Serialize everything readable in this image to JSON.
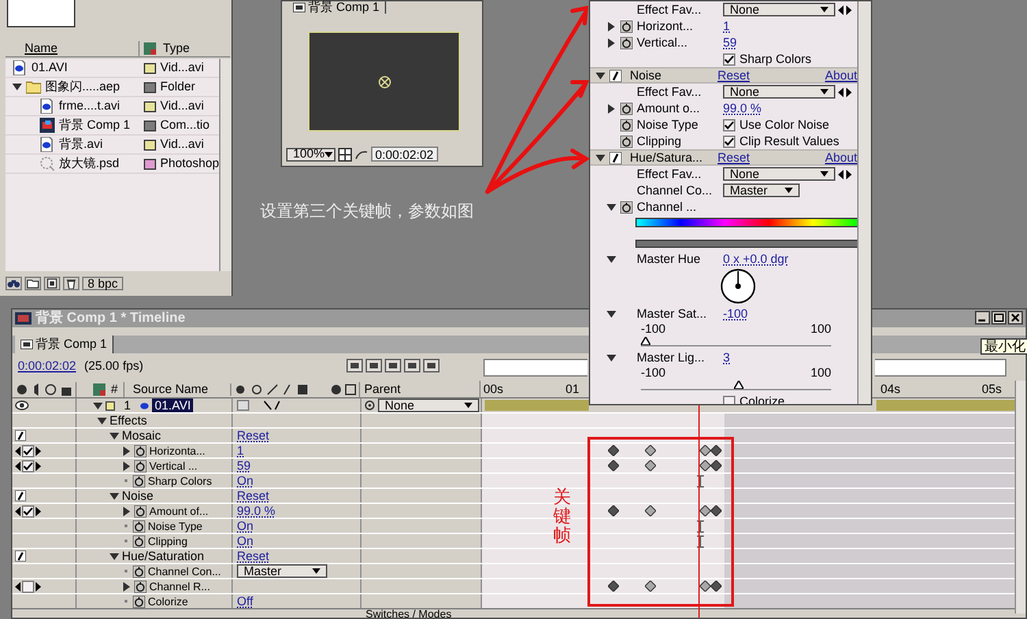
{
  "project": {
    "columns": [
      "Name",
      "Type"
    ],
    "items": [
      {
        "name": "01.AVI",
        "type": "Vid...avi",
        "kind": "footage",
        "color": "#e8e39a"
      },
      {
        "name": "图象闪.....aep",
        "type": "Folder",
        "kind": "folder",
        "color": "#7c7c7c",
        "expanded": true,
        "children": [
          {
            "name": "frme....t.avi",
            "type": "Vid...avi",
            "kind": "footage",
            "color": "#e8e39a"
          },
          {
            "name": "背景 Comp 1",
            "type": "Com...tio",
            "kind": "comp",
            "color": "#7c7c7c"
          },
          {
            "name": "背景.avi",
            "type": "Vid...avi",
            "kind": "footage",
            "color": "#e8e39a"
          },
          {
            "name": "放大镜.psd",
            "type": "Photoshop",
            "kind": "psd",
            "color": "#e09ad0"
          }
        ]
      }
    ],
    "bit_depth": "8 bpc"
  },
  "viewer": {
    "tab": "背景 Comp 1",
    "zoom": "100%",
    "timecode": "0:00:02:02"
  },
  "annotation": "设置第三个关键帧，参数如图",
  "effect_controls": {
    "sections": [
      {
        "items": [
          {
            "kind": "dropdown",
            "label": "Effect Fav...",
            "value": "None"
          },
          {
            "kind": "value",
            "label": "Horizont...",
            "value": "1"
          },
          {
            "kind": "value",
            "label": "Vertical...",
            "value": "59"
          },
          {
            "kind": "checkbox",
            "text": "Sharp Colors",
            "checked": true
          }
        ]
      },
      {
        "name": "Noise",
        "reset": "Reset",
        "about": "About",
        "items": [
          {
            "kind": "dropdown",
            "label": "Effect Fav...",
            "value": "None"
          },
          {
            "kind": "value",
            "label": "Amount o...",
            "value": "99.0 %"
          },
          {
            "kind": "checkbox",
            "label": "Noise Type",
            "text": "Use Color Noise",
            "checked": true
          },
          {
            "kind": "checkbox",
            "label": "Clipping",
            "text": "Clip Result Values",
            "checked": true
          }
        ]
      },
      {
        "name": "Hue/Satura...",
        "reset": "Reset",
        "about": "About",
        "items": [
          {
            "kind": "dropdown",
            "label": "Effect Fav...",
            "value": "None"
          },
          {
            "kind": "select",
            "label": "Channel Co...",
            "value": "Master"
          },
          {
            "kind": "colorbars",
            "label": "Channel ..."
          },
          {
            "kind": "angle",
            "label": "Master Hue",
            "value": "0 x +0.0 dgr"
          },
          {
            "kind": "slider",
            "label": "Master Sat...",
            "value": "-100",
            "min": "-100",
            "max": "100",
            "level": 0
          },
          {
            "kind": "slider",
            "label": "Master Lig...",
            "value": "3",
            "min": "-100",
            "max": "100",
            "level": 0.515
          },
          {
            "kind": "checkbox",
            "text": "Colorize",
            "checked": false
          }
        ]
      }
    ]
  },
  "timeline": {
    "title": "背景 Comp 1 * Timeline",
    "tab": "背景 Comp 1",
    "timecode": "0:00:02:02",
    "fps": "(25.00 fps)",
    "tooltip": "最小化",
    "columns": {
      "number": "#",
      "source": "Source Name",
      "parent": "Parent"
    },
    "ruler": [
      "00s",
      "01",
      "04s",
      "05s"
    ],
    "layers": [
      {
        "number": "1",
        "name": "01.AVI",
        "selected": true,
        "parent": "None",
        "expanded": true,
        "children": [
          {
            "kind": "group",
            "name": "Effects",
            "expanded": true,
            "children": [
              {
                "kind": "effect",
                "name": "Mosaic",
                "value": "Reset",
                "expanded": true,
                "children": [
                  {
                    "kind": "property",
                    "name": "Horizonta...",
                    "value": "1",
                    "keyframe_checked": true,
                    "animated": true
                  },
                  {
                    "kind": "property",
                    "name": "Vertical ...",
                    "value": "59",
                    "keyframe_checked": true,
                    "animated": true
                  },
                  {
                    "kind": "property",
                    "name": "Sharp Colors",
                    "value": "On",
                    "animated": false
                  }
                ]
              },
              {
                "kind": "effect",
                "name": "Noise",
                "value": "Reset",
                "expanded": true,
                "children": [
                  {
                    "kind": "property",
                    "name": "Amount of...",
                    "value": "99.0 %",
                    "keyframe_checked": true,
                    "animated": true
                  },
                  {
                    "kind": "property",
                    "name": "Noise Type",
                    "value": "On",
                    "animated": false
                  },
                  {
                    "kind": "property",
                    "name": "Clipping",
                    "value": "On",
                    "animated": false
                  }
                ]
              },
              {
                "kind": "effect",
                "name": "Hue/Saturation",
                "value": "Reset",
                "expanded": true,
                "children": [
                  {
                    "kind": "select",
                    "name": "Channel Con...",
                    "value": "Master"
                  },
                  {
                    "kind": "property",
                    "name": "Channel R...",
                    "keyframe_checked": false,
                    "animated": true
                  },
                  {
                    "kind": "property",
                    "name": "Colorize",
                    "value": "Off"
                  }
                ]
              }
            ]
          }
        ]
      }
    ],
    "footer": "Switches / Modes"
  },
  "keyframe_note": "关键帧"
}
